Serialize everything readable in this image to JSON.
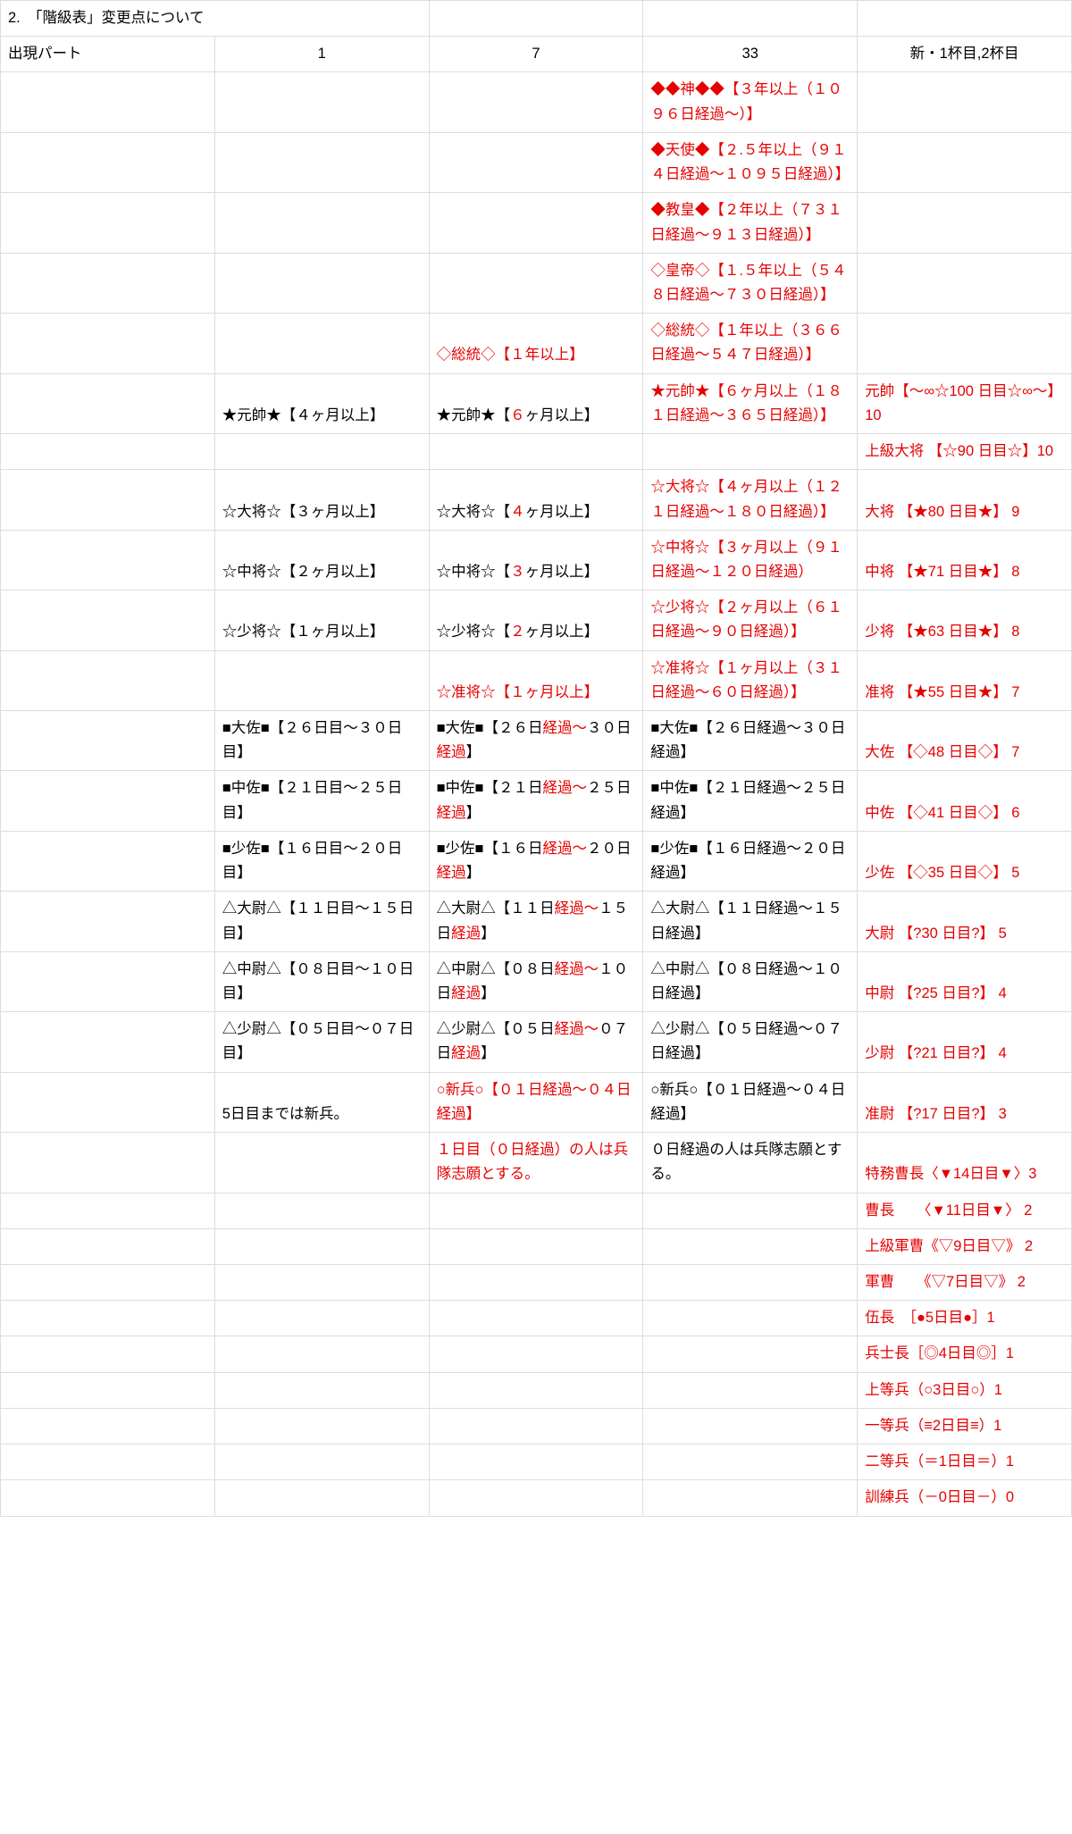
{
  "title": "2.　「階級表」変更点について",
  "columns": [
    "出現パート",
    "1",
    "7",
    "33",
    "新・1杯目,2杯目"
  ],
  "rows": [
    {
      "c0": [],
      "c1": [],
      "c2": [],
      "c3": [
        {
          "t": "◆◆神◆◆【３年以上（１０９６日経過〜）】",
          "c": "red"
        }
      ],
      "c4": []
    },
    {
      "c0": [],
      "c1": [],
      "c2": [],
      "c3": [
        {
          "t": "◆天使◆【２.５年以上（９１４日経過〜１０９５日経過）】",
          "c": "red"
        }
      ],
      "c4": []
    },
    {
      "c0": [],
      "c1": [],
      "c2": [],
      "c3": [
        {
          "t": "◆教皇◆【２年以上（７３１日経過〜９１３日経過）】",
          "c": "red"
        }
      ],
      "c4": []
    },
    {
      "c0": [],
      "c1": [],
      "c2": [],
      "c3": [
        {
          "t": "◇皇帝◇【１.５年以上（５４８日経過〜７３０日経過）】",
          "c": "red"
        }
      ],
      "c4": []
    },
    {
      "c0": [],
      "c1": [],
      "c2": [
        {
          "t": "◇総統◇【１年以上】",
          "c": "red"
        }
      ],
      "c3": [
        {
          "t": "◇総統◇【１年以上（３６６日経過〜５４７日経過）】",
          "c": "red"
        }
      ],
      "c4": []
    },
    {
      "c0": [],
      "c1": [
        {
          "t": "★元帥★【４ヶ月以上】",
          "c": "black"
        }
      ],
      "c2": [
        {
          "t": "★元帥★【",
          "c": "black"
        },
        {
          "t": "６",
          "c": "red"
        },
        {
          "t": "ヶ月以上】",
          "c": "black"
        }
      ],
      "c3": [
        {
          "t": "★元帥★【６ヶ月以上（１８１日経過〜３６５日経過）】",
          "c": "red"
        }
      ],
      "c4": [
        {
          "t": "元帥【〜∞☆100 日目☆∞〜】10",
          "c": "red"
        }
      ]
    },
    {
      "c0": [],
      "c1": [],
      "c2": [],
      "c3": [],
      "c4": [
        {
          "t": "上級大将 【☆90 日目☆】10",
          "c": "red"
        }
      ]
    },
    {
      "c0": [],
      "c1": [
        {
          "t": "☆大将☆【３ヶ月以上】",
          "c": "black"
        }
      ],
      "c2": [
        {
          "t": "☆大将☆【",
          "c": "black"
        },
        {
          "t": "４",
          "c": "red"
        },
        {
          "t": "ヶ月以上】",
          "c": "black"
        }
      ],
      "c3": [
        {
          "t": "☆大将☆【４ヶ月以上（１２１日経過〜１８０日経過）】",
          "c": "red"
        }
      ],
      "c4": [
        {
          "t": "大将 【★80 日目★】 9",
          "c": "red"
        }
      ]
    },
    {
      "c0": [],
      "c1": [
        {
          "t": "☆中将☆【２ヶ月以上】",
          "c": "black"
        }
      ],
      "c2": [
        {
          "t": "☆中将☆【",
          "c": "black"
        },
        {
          "t": "３",
          "c": "red"
        },
        {
          "t": "ヶ月以上】",
          "c": "black"
        }
      ],
      "c3": [
        {
          "t": "☆中将☆【３ヶ月以上（９１日経過〜１２０日経過）",
          "c": "red"
        }
      ],
      "c4": [
        {
          "t": "中将 【★71 日目★】 8",
          "c": "red"
        }
      ]
    },
    {
      "c0": [],
      "c1": [
        {
          "t": "☆少将☆【１ヶ月以上】",
          "c": "black"
        }
      ],
      "c2": [
        {
          "t": "☆少将☆【",
          "c": "black"
        },
        {
          "t": "２",
          "c": "red"
        },
        {
          "t": "ヶ月以上】",
          "c": "black"
        }
      ],
      "c3": [
        {
          "t": "☆少将☆【２ヶ月以上（６１日経過〜９０日経過）】",
          "c": "red"
        }
      ],
      "c4": [
        {
          "t": "少将 【★63 日目★】 8",
          "c": "red"
        }
      ]
    },
    {
      "c0": [],
      "c1": [],
      "c2": [
        {
          "t": "☆准将☆【１ヶ月以上】",
          "c": "red"
        }
      ],
      "c3": [
        {
          "t": "☆准将☆【１ヶ月以上（３１日経過〜６０日経過）】",
          "c": "red"
        }
      ],
      "c4": [
        {
          "t": "准将 【★55 日目★】 7",
          "c": "red"
        }
      ]
    },
    {
      "c0": [],
      "c1": [
        {
          "t": "■大佐■【２６日目〜３０日目】",
          "c": "black"
        }
      ],
      "c2": [
        {
          "t": "■大佐■【２６日",
          "c": "black"
        },
        {
          "t": "経過〜",
          "c": "red"
        },
        {
          "t": "３０日",
          "c": "black"
        },
        {
          "t": "経過",
          "c": "red"
        },
        {
          "t": "】",
          "c": "black"
        }
      ],
      "c3": [
        {
          "t": "■大佐■【２６日経過〜３０日経過】",
          "c": "black"
        }
      ],
      "c4": [
        {
          "t": "大佐 【◇48 日目◇】 7",
          "c": "red"
        }
      ]
    },
    {
      "c0": [],
      "c1": [
        {
          "t": "■中佐■【２１日目〜２５日目】",
          "c": "black"
        }
      ],
      "c2": [
        {
          "t": "■中佐■【２１日",
          "c": "black"
        },
        {
          "t": "経過〜",
          "c": "red"
        },
        {
          "t": "２５日",
          "c": "black"
        },
        {
          "t": "経過",
          "c": "red"
        },
        {
          "t": "】",
          "c": "black"
        }
      ],
      "c3": [
        {
          "t": "■中佐■【２１日経過〜２５日経過】",
          "c": "black"
        }
      ],
      "c4": [
        {
          "t": "中佐 【◇41 日目◇】 6",
          "c": "red"
        }
      ]
    },
    {
      "c0": [],
      "c1": [
        {
          "t": "■少佐■【１６日目〜２０日目】",
          "c": "black"
        }
      ],
      "c2": [
        {
          "t": "■少佐■【１６日",
          "c": "black"
        },
        {
          "t": "経過〜",
          "c": "red"
        },
        {
          "t": "２０日",
          "c": "black"
        },
        {
          "t": "経過",
          "c": "red"
        },
        {
          "t": "】",
          "c": "black"
        }
      ],
      "c3": [
        {
          "t": "■少佐■【１６日経過〜２０日経過】",
          "c": "black"
        }
      ],
      "c4": [
        {
          "t": "少佐 【◇35 日目◇】 5",
          "c": "red"
        }
      ]
    },
    {
      "c0": [],
      "c1": [
        {
          "t": "△大尉△【１１日目〜１５日目】",
          "c": "black"
        }
      ],
      "c2": [
        {
          "t": "△大尉△【１１日",
          "c": "black"
        },
        {
          "t": "経過〜",
          "c": "red"
        },
        {
          "t": "１５日",
          "c": "black"
        },
        {
          "t": "経過",
          "c": "red"
        },
        {
          "t": "】",
          "c": "black"
        }
      ],
      "c3": [
        {
          "t": "△大尉△【１１日経過〜１５日経過】",
          "c": "black"
        }
      ],
      "c4": [
        {
          "t": "大尉 【?30 日目?】 5",
          "c": "red"
        }
      ]
    },
    {
      "c0": [],
      "c1": [
        {
          "t": "△中尉△【０８日目〜１０日目】",
          "c": "black"
        }
      ],
      "c2": [
        {
          "t": "△中尉△【０８日",
          "c": "black"
        },
        {
          "t": "経過〜",
          "c": "red"
        },
        {
          "t": "１０日",
          "c": "black"
        },
        {
          "t": "経過",
          "c": "red"
        },
        {
          "t": "】",
          "c": "black"
        }
      ],
      "c3": [
        {
          "t": "△中尉△【０８日経過〜１０日経過】",
          "c": "black"
        }
      ],
      "c4": [
        {
          "t": "中尉 【?25 日目?】 4",
          "c": "red"
        }
      ]
    },
    {
      "c0": [],
      "c1": [
        {
          "t": "△少尉△【０５日目〜０７日目】",
          "c": "black"
        }
      ],
      "c2": [
        {
          "t": "△少尉△【０５日",
          "c": "black"
        },
        {
          "t": "経過〜",
          "c": "red"
        },
        {
          "t": "０７日",
          "c": "black"
        },
        {
          "t": "経過",
          "c": "red"
        },
        {
          "t": "】",
          "c": "black"
        }
      ],
      "c3": [
        {
          "t": "△少尉△【０５日経過〜０７日経過】",
          "c": "black"
        }
      ],
      "c4": [
        {
          "t": "少尉 【?21 日目?】 4",
          "c": "red"
        }
      ]
    },
    {
      "c0": [],
      "c1": [
        {
          "t": "5日目までは新兵。",
          "c": "black"
        }
      ],
      "c2": [
        {
          "t": "○新兵○【０１日経過〜０４日経過】",
          "c": "red"
        }
      ],
      "c3": [
        {
          "t": "○新兵○【０１日経過〜０４日経過】",
          "c": "black"
        }
      ],
      "c4": [
        {
          "t": "准尉 【?17 日目?】 3",
          "c": "red"
        }
      ]
    },
    {
      "c0": [],
      "c1": [],
      "c2": [
        {
          "t": "１日目（０日経過）の人は兵隊志願とする。",
          "c": "red"
        }
      ],
      "c3": [
        {
          "t": "０日経過の人は兵隊志願とする。",
          "c": "black"
        }
      ],
      "c4": [
        {
          "t": "特務曹長〈▼14日目▼〉3",
          "c": "red"
        }
      ]
    },
    {
      "c0": [],
      "c1": [],
      "c2": [],
      "c3": [],
      "c4": [
        {
          "t": "曹長　　〈▼11日目▼〉 2",
          "c": "red"
        }
      ]
    },
    {
      "c0": [],
      "c1": [],
      "c2": [],
      "c3": [],
      "c4": [
        {
          "t": "上級軍曹《▽9日目▽》 2",
          "c": "red"
        }
      ]
    },
    {
      "c0": [],
      "c1": [],
      "c2": [],
      "c3": [],
      "c4": [
        {
          "t": "軍曹　　《▽7日目▽》 2",
          "c": "red"
        }
      ]
    },
    {
      "c0": [],
      "c1": [],
      "c2": [],
      "c3": [],
      "c4": [
        {
          "t": "伍長　［●5日目●］1",
          "c": "red"
        }
      ]
    },
    {
      "c0": [],
      "c1": [],
      "c2": [],
      "c3": [],
      "c4": [
        {
          "t": "兵士長［◎4日目◎］1",
          "c": "red"
        }
      ]
    },
    {
      "c0": [],
      "c1": [],
      "c2": [],
      "c3": [],
      "c4": [
        {
          "t": "上等兵（○3日目○）1",
          "c": "red"
        }
      ]
    },
    {
      "c0": [],
      "c1": [],
      "c2": [],
      "c3": [],
      "c4": [
        {
          "t": "一等兵（≡2日目≡）1",
          "c": "red"
        }
      ]
    },
    {
      "c0": [],
      "c1": [],
      "c2": [],
      "c3": [],
      "c4": [
        {
          "t": "二等兵（＝1日目＝）1",
          "c": "red"
        }
      ]
    },
    {
      "c0": [],
      "c1": [],
      "c2": [],
      "c3": [],
      "c4": [
        {
          "t": "訓練兵（－0日目－）0",
          "c": "red"
        }
      ]
    }
  ]
}
